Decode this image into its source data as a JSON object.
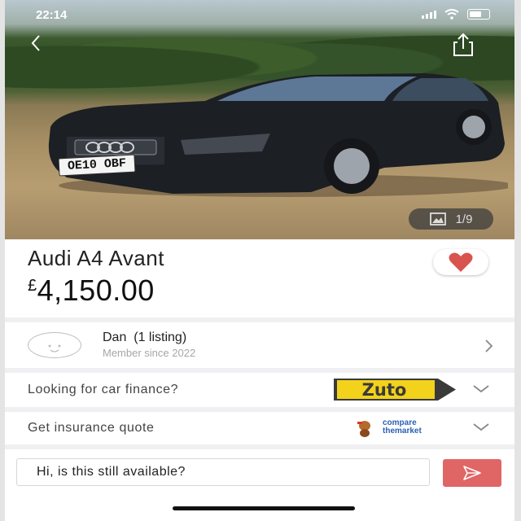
{
  "status_bar": {
    "time": "22:14"
  },
  "gallery": {
    "photo_counter": "1/9",
    "number_plate": "OE10 OBF"
  },
  "listing": {
    "title": "Audi A4 Avant",
    "price_currency": "£",
    "price_amount": "4,150.00"
  },
  "seller": {
    "name": "Dan  (1 listing)",
    "member_since": "Member since 2022"
  },
  "finance": {
    "label": "Looking for car finance?",
    "partner_logo_text": "Zuto"
  },
  "insurance": {
    "label": "Get insurance quote",
    "partner_logo_line1": "compare",
    "partner_logo_line2": "themarket"
  },
  "message": {
    "value": "Hi, is this still available?"
  },
  "colors": {
    "accent": "#e06666",
    "favorite_heart": "#d9534f",
    "zuto_yellow": "#f2d21b"
  }
}
